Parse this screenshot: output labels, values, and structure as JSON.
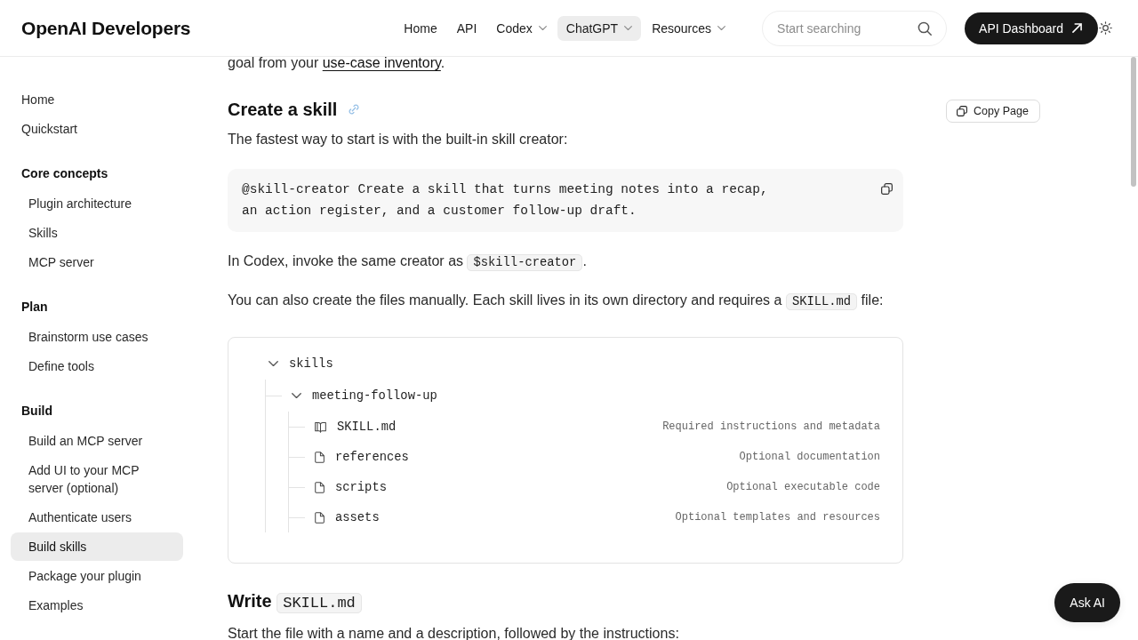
{
  "header": {
    "logo": "OpenAI Developers",
    "nav": [
      {
        "label": "Home",
        "dropdown": false,
        "selected": false
      },
      {
        "label": "API",
        "dropdown": false,
        "selected": false
      },
      {
        "label": "Codex",
        "dropdown": true,
        "selected": false
      },
      {
        "label": "ChatGPT",
        "dropdown": true,
        "selected": true
      },
      {
        "label": "Resources",
        "dropdown": true,
        "selected": false
      }
    ],
    "search": {
      "placeholder": "Start searching"
    },
    "dashboard_button": "API Dashboard"
  },
  "sidebar": {
    "sections": [
      {
        "items": [
          {
            "label": "Home",
            "selected": false
          },
          {
            "label": "Quickstart",
            "selected": false
          }
        ]
      },
      {
        "title": "Core concepts",
        "items": [
          {
            "label": "Plugin architecture",
            "selected": false
          },
          {
            "label": "Skills",
            "selected": false
          },
          {
            "label": "MCP server",
            "selected": false
          }
        ]
      },
      {
        "title": "Plan",
        "items": [
          {
            "label": "Brainstorm use cases",
            "selected": false
          },
          {
            "label": "Define tools",
            "selected": false
          }
        ]
      },
      {
        "title": "Build",
        "items": [
          {
            "label": "Build an MCP server",
            "selected": false
          },
          {
            "label": "Add UI to your MCP server (optional)",
            "selected": false
          },
          {
            "label": "Authenticate users",
            "selected": false
          },
          {
            "label": "Build skills",
            "selected": true
          },
          {
            "label": "Package your plugin",
            "selected": false
          },
          {
            "label": "Examples",
            "selected": false
          }
        ]
      }
    ]
  },
  "content": [
    {
      "kind": "paragraph",
      "parts": [
        {
          "kind": "text",
          "text": "goal from your "
        },
        {
          "kind": "link",
          "text": "use-case inventory"
        },
        {
          "kind": "text",
          "text": "."
        }
      ]
    },
    {
      "kind": "heading",
      "hovered": true,
      "parts": [
        {
          "kind": "text",
          "text": "Create a skill"
        }
      ]
    },
    {
      "kind": "paragraph",
      "parts": [
        {
          "kind": "text",
          "text": "The fastest way to start is with the built-in skill creator:"
        }
      ]
    },
    {
      "kind": "code",
      "lines": [
        "@skill-creator Create a skill that turns meeting notes into a recap,",
        "an action register, and a customer follow-up draft."
      ]
    },
    {
      "kind": "paragraph",
      "parts": [
        {
          "kind": "text",
          "text": "In Codex, invoke the same creator as "
        },
        {
          "kind": "code",
          "text": "$skill-creator"
        },
        {
          "kind": "text",
          "text": "."
        }
      ]
    },
    {
      "kind": "paragraph",
      "parts": [
        {
          "kind": "text",
          "text": "You can also create the files manually. Each skill lives in its own directory and requires a "
        },
        {
          "kind": "code",
          "text": "SKILL.md"
        },
        {
          "kind": "text",
          "text": " file:"
        }
      ]
    },
    {
      "kind": "tree",
      "root": [
        {
          "kind": "folder",
          "name": "skills",
          "expanded": true,
          "children": [
            {
              "kind": "folder",
              "name": "meeting-follow-up",
              "expanded": true,
              "children": [
                {
                  "kind": "book",
                  "name": "SKILL.md",
                  "description": "Required instructions and metadata"
                },
                {
                  "kind": "file",
                  "name": "references",
                  "description": "Optional documentation"
                },
                {
                  "kind": "file",
                  "name": "scripts",
                  "description": "Optional executable code"
                },
                {
                  "kind": "file",
                  "name": "assets",
                  "description": "Optional templates and resources"
                }
              ]
            }
          ]
        }
      ]
    },
    {
      "kind": "heading",
      "hovered": false,
      "parts": [
        {
          "kind": "text",
          "text": "Write "
        },
        {
          "kind": "code",
          "text": "SKILL.md"
        }
      ]
    },
    {
      "kind": "paragraph",
      "parts": [
        {
          "kind": "text",
          "text": "Start the file with a name and a description, followed by the instructions:"
        }
      ]
    }
  ],
  "copy_page_button": "Copy Page",
  "ask_ai_button": "Ask AI"
}
